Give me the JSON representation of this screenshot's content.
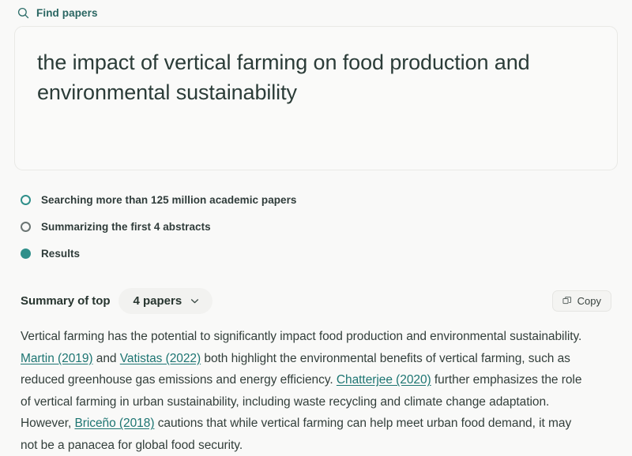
{
  "header": {
    "search_icon": "search-icon",
    "label": "Find papers"
  },
  "query": {
    "text": "the impact of vertical farming on food production and environmental sustainability"
  },
  "steps": [
    {
      "label": "Searching more than 125 million academic papers",
      "state": "teal-ring"
    },
    {
      "label": "Summarizing the first 4 abstracts",
      "state": "gray-ring"
    },
    {
      "label": "Results",
      "state": "filled"
    }
  ],
  "summary": {
    "title": "Summary of top",
    "papers_value": "4 papers",
    "chevron_icon": "chevron-down-icon",
    "copy_icon": "copy-icon",
    "copy_label": "Copy",
    "body": [
      {
        "type": "text",
        "value": "Vertical farming has the potential to significantly impact food production and environmental sustainability. "
      },
      {
        "type": "cite",
        "value": "Martin (2019)"
      },
      {
        "type": "text",
        "value": " and "
      },
      {
        "type": "cite",
        "value": "Vatistas (2022)"
      },
      {
        "type": "text",
        "value": " both highlight the environmental benefits of vertical farming, such as reduced greenhouse gas emissions and energy efficiency. "
      },
      {
        "type": "cite",
        "value": "Chatterjee (2020)"
      },
      {
        "type": "text",
        "value": " further emphasizes the role of vertical farming in urban sustainability, including waste recycling and climate change adaptation. However, "
      },
      {
        "type": "cite",
        "value": "Briceño (2018)"
      },
      {
        "type": "text",
        "value": " cautions that while vertical farming can help meet urban food demand, it may not be a panacea for global food security."
      }
    ]
  },
  "colors": {
    "accent_teal": "#2f8f8a",
    "link_teal": "#1d7572",
    "header_teal": "#2a6662",
    "page_bg": "#f9f9f8",
    "text_dark": "#2b3c38"
  }
}
